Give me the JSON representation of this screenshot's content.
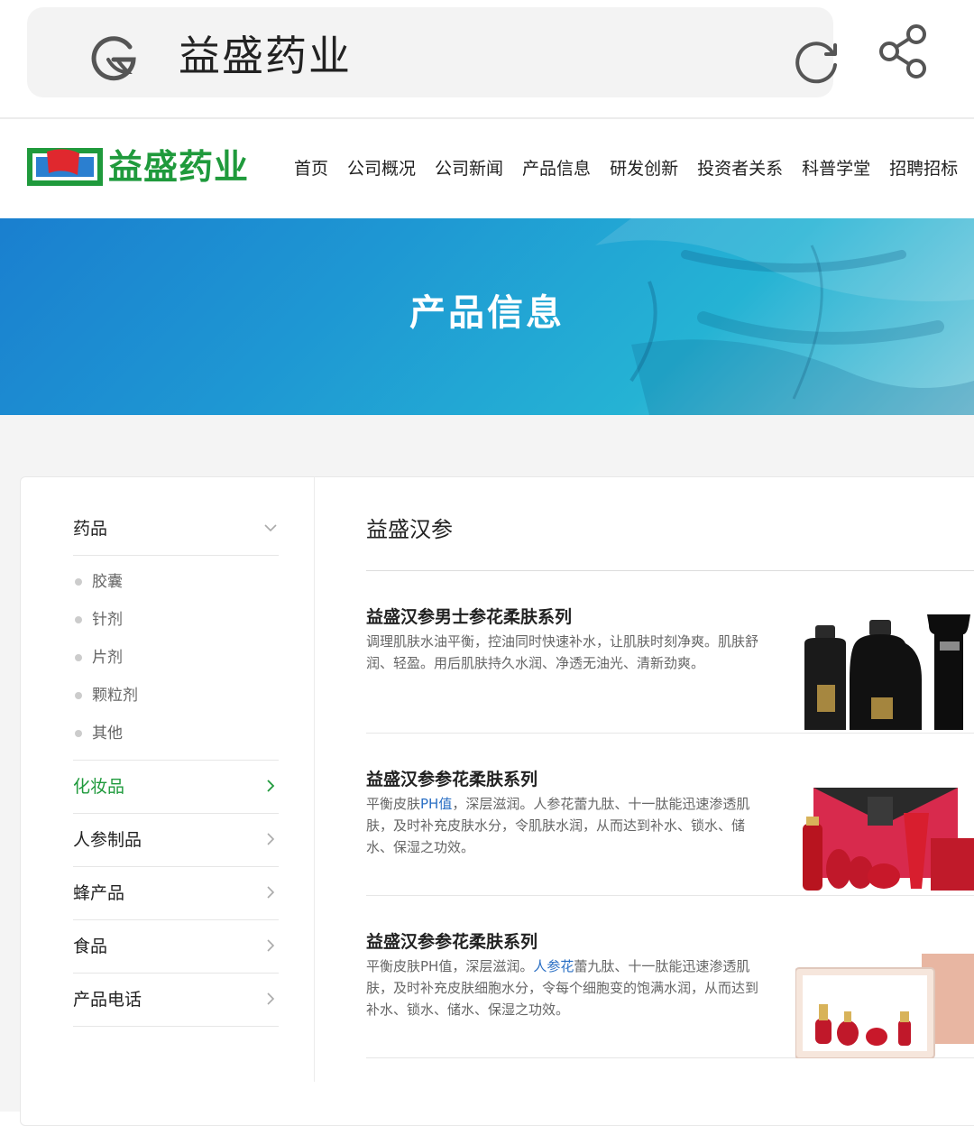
{
  "browser": {
    "query": "益盛药业"
  },
  "site": {
    "logo_text": "益盛药业",
    "nav": [
      "首页",
      "公司概况",
      "公司新闻",
      "产品信息",
      "研发创新",
      "投资者关系",
      "科普学堂",
      "招聘招标"
    ]
  },
  "banner": {
    "title": "产品信息"
  },
  "sidebar": {
    "categories": [
      {
        "label": "药品",
        "expanded": true,
        "sub": [
          "胶囊",
          "针剂",
          "片剂",
          "颗粒剂",
          "其他"
        ]
      },
      {
        "label": "化妆品",
        "active": true
      },
      {
        "label": "人参制品"
      },
      {
        "label": "蜂产品"
      },
      {
        "label": "食品"
      },
      {
        "label": "产品电话"
      }
    ]
  },
  "main": {
    "section_title": "益盛汉参",
    "products": [
      {
        "title": "益盛汉参男士参花柔肤系列",
        "desc": "调理肌肤水油平衡，控油同时快速补水，让肌肤时刻净爽。肌肤舒润、轻盈。用后肌肤持久水润、净透无油光、清新劲爽。"
      },
      {
        "title": "益盛汉参参花柔肤系列",
        "desc_pre": "平衡皮肤",
        "desc_hl": "PH值",
        "desc_post": "，深层滋润。人参花蕾九肽、十一肽能迅速渗透肌肤，及时补充皮肤水分，令肌肤水润，从而达到补水、锁水、储水、保湿之功效。"
      },
      {
        "title": "益盛汉参参花柔肤系列",
        "desc_pre": "平衡皮肤PH值，深层滋润。",
        "desc_hl": "人参花",
        "desc_post": "蕾九肽、十一肽能迅速渗透肌肤，及时补充皮肤细胞水分，令每个细胞变的饱满水润，从而达到补水、锁水、储水、保湿之功效。"
      }
    ]
  },
  "colors": {
    "brand_green": "#1f9a3c",
    "link_blue": "#2a6fc4",
    "banner_blue": "#1e97d3"
  }
}
